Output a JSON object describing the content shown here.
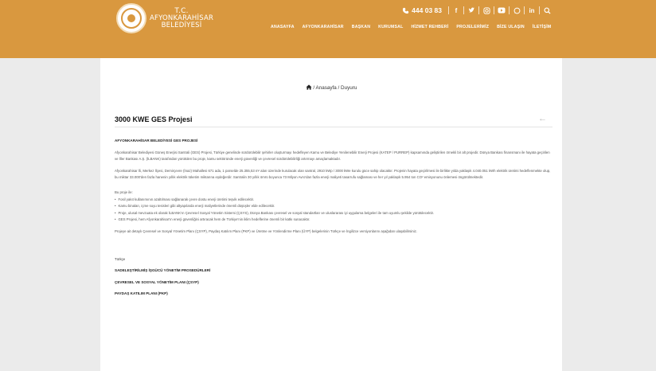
{
  "brand": {
    "line1": "T.C.",
    "line2": "AFYONKARAHİSAR",
    "line3": "BELEDİYESİ"
  },
  "topbar": {
    "phone": "444 03 83"
  },
  "nav": [
    "ANASAYFA",
    "AFYONKARAHİSAR",
    "BAŞKAN",
    "KURUMSAL",
    "HİZMET REHBERİ",
    "PROJELERİMİZ",
    "BİZE ULAŞIN",
    "İLETİŞİM"
  ],
  "breadcrumb": {
    "text": "/ Anasayfa / Duyuru"
  },
  "page": {
    "title": "3000 KWE GES Projesi"
  },
  "body": {
    "heading": "AFYONKARAHİSAR BELEDİYESİ GES PROJESİ",
    "p1": "Afyonkarahisar Belediyesi Güneş Enerjisi Santrali (GES) Projesi, Türkiye genelinde sürdürülebilir şehirler oluşturmayı hedefleyen Kamu ve Belediye Yenilenebilir Enerji Projesi (KATEP / PURREP) kapsamında geliştirilen örnekli bir alt projedir. Dünya Bankası finansmanı ile hayata geçirilen ve İller Bankası A.Ş. (İLBANK) tarafından yürütülen bu proje, kamu sektöründe enerji güvenliği ve çevresel sürdürülebilirliği artırmayı amaçlamaktadır.",
    "p2": "Afyonkarahisar İli, Merkez İlçesi, Demirçevre (İnaz) Mahallesi 671 ada, 1 parselde 25.355,53 m² alan üzerinde kurulacak olan santral, 2910 kWp / 3000 kWe kurulu güce sahip olacaktır. Projenin hayata geçirilmesi ile birlikte yılda yaklaşık 4.040.051 kWh elektrik üretimi hedeflenmekte olup, bu miktar 33.000'den fazla hanenin yıllık elektrik tüketim miktarına eşdeğerdir. Santralin 30 yıllık ömrü boyunca 73 Milyon Avro'dan fazla enerji maliyeti tasarrufu sağlaması ve her yıl yaklaşık 5.954 ton CO² emisyonunu önlemesi öngörülmektedir.",
    "intro": "Bu proje ile:",
    "bullets": [
      "Fosil yakıt kullanımının azaltılması sağlanarak çevre dostu enerji üretimi teşvik edilecektir.",
      "Kamu binaları, içme suyu tesisleri gibi altyapılarda enerji maliyetlerinde önemli düşüşler elde edilecektir.",
      "Proje, ulusal mevzuata ek olarak İLBANK'ın Çevresel Sosyal Yönetim Sistemi (ÇSYS), Dünya Bankası çevresel ve sosyal standartları ve uluslararası iyi uygulama belgeleri ile tam uyumlu şekilde yürütülecektir.",
      "GES Projesi, hem Afyonkarahisar'ın enerji güvenliğini artıracak hem de Türkiye'nin iklim hedeflerine önemli bir katkı sunacaktır."
    ],
    "p3": "Projeye ait detaylı Çevresel ve Sosyal Yönetim Planı (ÇSYP), Paydaş Katılım Planı (PKP) ve Üretme ve Yönlendirme Planı (ÜYP) belgelerinin Türkçe ve İngilizce versiyonlarını aşağıdan ulaşabilirsiniz.",
    "lang_label": "Türkçe",
    "docs": [
      "SADELEŞTİRİLMİŞ İŞGÜCÜ YÖNETİM PROSEDÜRLERİ",
      "ÇEVRESEL VE SOSYAL YÖNETİM PLANI (ÇSYP)",
      "PAYDAŞ KATILIM PLANI (PKP)"
    ]
  },
  "colors": {
    "accent": "#d9983f",
    "background": "#ebebeb"
  },
  "icons": [
    "seal-logo",
    "phone-icon",
    "facebook-icon",
    "twitter-icon",
    "instagram-icon",
    "youtube-icon",
    "whatsapp-icon",
    "linkedin-icon",
    "search-icon",
    "home-icon",
    "arrow-left-icon"
  ]
}
